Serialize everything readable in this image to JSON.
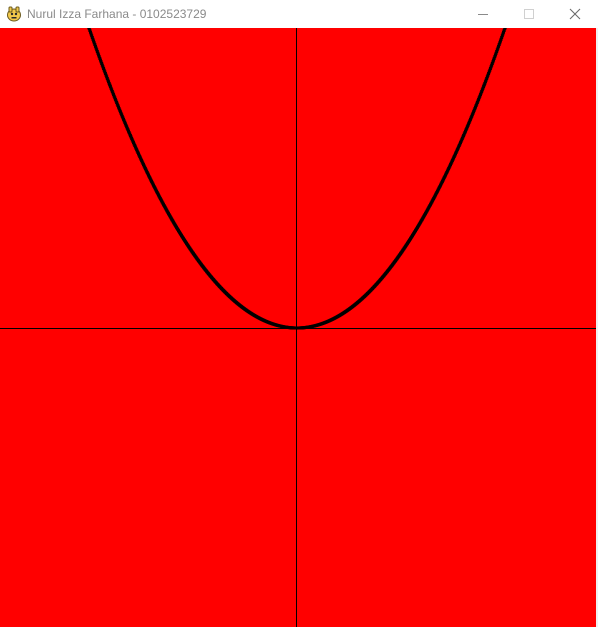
{
  "window": {
    "title": "Nurul Izza Farhana - 0102523729",
    "icon": "pygame-snake-icon",
    "controls": [
      "minimize-icon",
      "maximize-icon",
      "close-icon"
    ]
  },
  "canvas": {
    "background": "#ff0000",
    "axis_color": "#000000",
    "curve_color": "#000000"
  },
  "chart_data": {
    "type": "line",
    "function": "y = x^2",
    "grid": false,
    "series": [
      {
        "x": [
          -2.0,
          -1.8,
          -1.6,
          -1.4,
          -1.2,
          -1.0,
          -0.8,
          -0.6,
          -0.4,
          -0.2,
          0.0,
          0.2,
          0.4,
          0.6,
          0.8,
          1.0,
          1.2,
          1.4,
          1.6,
          1.8,
          2.0
        ],
        "y": [
          4.0,
          3.24,
          2.56,
          1.96,
          1.44,
          1.0,
          0.64,
          0.36,
          0.16,
          0.04,
          0.0,
          0.04,
          0.16,
          0.36,
          0.64,
          1.0,
          1.44,
          1.96,
          2.56,
          3.24,
          4.0
        ]
      }
    ]
  }
}
